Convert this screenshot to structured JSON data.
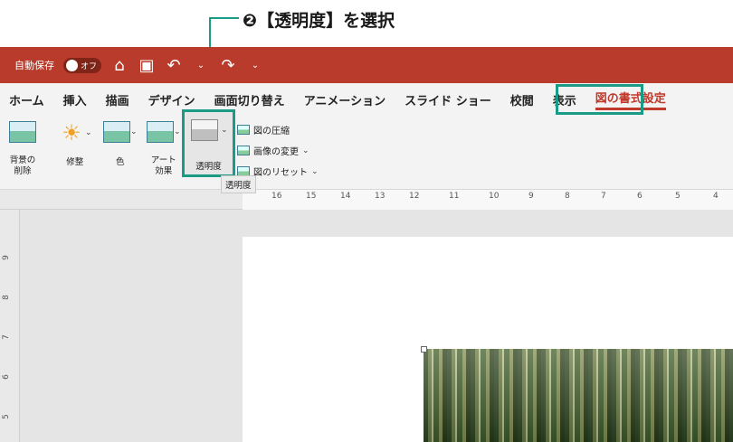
{
  "callout": {
    "text": "❷【透明度】を選択"
  },
  "titlebar": {
    "autosave_label": "自動保存",
    "toggle_text": "オフ",
    "icons": [
      "home-icon",
      "save-icon",
      "undo-icon",
      "redo-icon"
    ]
  },
  "tabs": [
    "ホーム",
    "挿入",
    "描画",
    "デザイン",
    "画面切り替え",
    "アニメーション",
    "スライド ショー",
    "校閲",
    "表示",
    "図の書式設定"
  ],
  "active_tab": "図の書式設定",
  "ribbon": {
    "remove_bg": "背景の\n削除",
    "corrections": "修整",
    "color": "色",
    "artistic": "アート\n効果",
    "transparency": "透明度",
    "compress": "図の圧縮",
    "change_picture": "画像の変更",
    "reset_picture": "図のリセット",
    "tooltip": "透明度"
  },
  "ruler": {
    "numbers": [
      "16",
      "15",
      "14",
      "13",
      "12",
      "11",
      "10",
      "9",
      "8",
      "7",
      "6",
      "5",
      "4"
    ]
  },
  "vruler": {
    "numbers": [
      "9",
      "8",
      "7",
      "6",
      "5"
    ]
  }
}
